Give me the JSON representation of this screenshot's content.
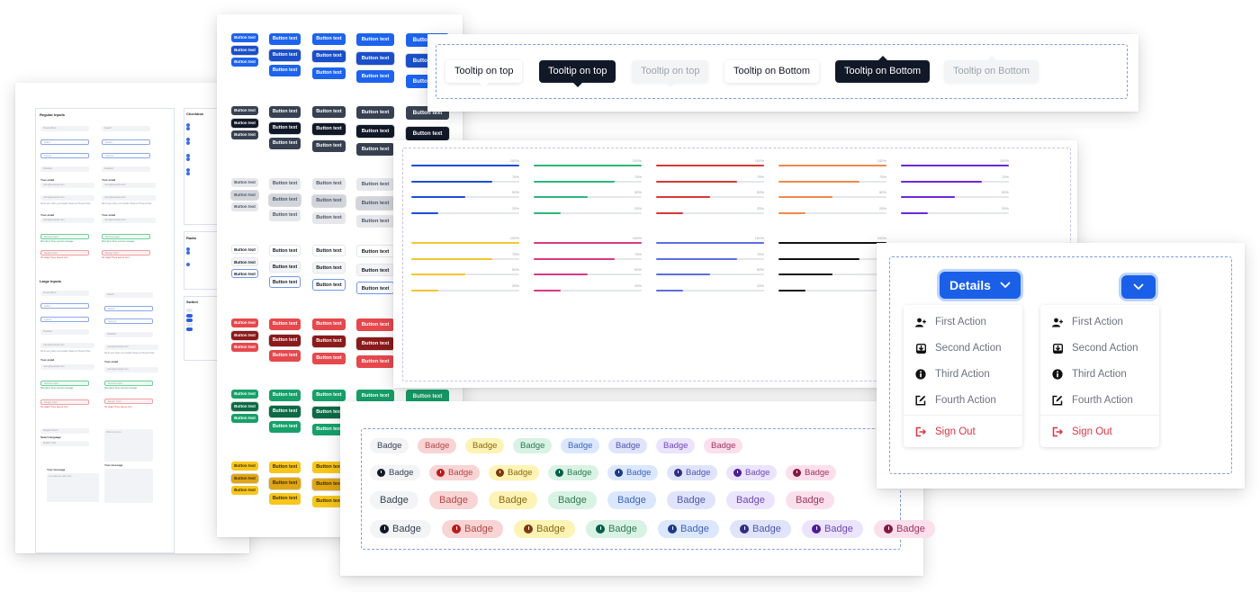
{
  "tooltips": {
    "items": [
      {
        "label": "Tooltip on top",
        "variant": "light",
        "placement": "top"
      },
      {
        "label": "Tooltip on top",
        "variant": "dark",
        "placement": "top"
      },
      {
        "label": "Tooltip on top",
        "variant": "muted",
        "placement": "top"
      },
      {
        "label": "Tooltip on Bottom",
        "variant": "light",
        "placement": "bottom"
      },
      {
        "label": "Tooltip on Bottom",
        "variant": "dark",
        "placement": "bottom"
      },
      {
        "label": "Tooltip on Bottom",
        "variant": "muted",
        "placement": "bottom"
      }
    ]
  },
  "dropdowns": {
    "details_button": "Details",
    "icon_button": "chevron-down",
    "menus": [
      {
        "items": [
          {
            "label": "First Action",
            "icon": "user-plus-icon"
          },
          {
            "label": "Second Action",
            "icon": "download-box-icon"
          },
          {
            "label": "Third Action",
            "icon": "info-circle-icon"
          },
          {
            "label": "Fourth Action",
            "icon": "edit-icon"
          }
        ],
        "danger_item": {
          "label": "Sign Out",
          "icon": "sign-out-icon"
        }
      },
      {
        "items": [
          {
            "label": "First Action",
            "icon": "user-plus-icon"
          },
          {
            "label": "Second Action",
            "icon": "download-box-icon"
          },
          {
            "label": "Third Action",
            "icon": "info-circle-icon"
          },
          {
            "label": "Fourth Action",
            "icon": "edit-icon"
          }
        ],
        "danger_item": {
          "label": "Sign Out",
          "icon": "sign-out-icon"
        }
      }
    ],
    "accent": "#1a5fe8",
    "danger": "#dc3545"
  },
  "badges": {
    "label": "Badge",
    "icon": "clock-icon",
    "palettes": [
      {
        "name": "gray",
        "bg": "#f3f4f6",
        "fg": "#374151",
        "icon": "#111827"
      },
      {
        "name": "red",
        "bg": "#f8d4d4",
        "fg": "#b54848",
        "icon": "#b91c1c"
      },
      {
        "name": "yellow",
        "bg": "#fdf3b5",
        "fg": "#8a6a10",
        "icon": "#7c3a10"
      },
      {
        "name": "green",
        "bg": "#d8f2e4",
        "fg": "#2f7a55",
        "icon": "#065f46"
      },
      {
        "name": "blue",
        "bg": "#dbe7fd",
        "fg": "#3e64b8",
        "icon": "#1e3a8a"
      },
      {
        "name": "indigo",
        "bg": "#e0e4fb",
        "fg": "#4d55b0",
        "icon": "#312e81"
      },
      {
        "name": "purple",
        "bg": "#ebe4fc",
        "fg": "#6d48b8",
        "icon": "#4c1d95"
      },
      {
        "name": "pink",
        "bg": "#fbe0eb",
        "fg": "#a2335e",
        "icon": "#831843"
      }
    ],
    "rows": [
      {
        "size": "small",
        "with_icon": false
      },
      {
        "size": "small",
        "with_icon": true
      },
      {
        "size": "large",
        "with_icon": false
      },
      {
        "size": "large",
        "with_icon": true
      }
    ]
  },
  "progress": {
    "groups": [
      {
        "color": "#1d4ed8",
        "values": [
          100,
          75,
          50,
          25
        ]
      },
      {
        "color": "#2fb57a",
        "values": [
          100,
          75,
          50,
          25
        ]
      },
      {
        "color": "#d63838",
        "values": [
          100,
          75,
          50,
          25
        ]
      },
      {
        "color": "#f0894a",
        "values": [
          100,
          75,
          50,
          25
        ]
      },
      {
        "color": "#6d28d9",
        "values": [
          100,
          75,
          50,
          25
        ]
      },
      {
        "color": "#f5c431",
        "values": [
          100,
          75,
          50,
          25
        ]
      },
      {
        "color": "#d83a86",
        "values": [
          100,
          75,
          50,
          25
        ]
      },
      {
        "color": "#5b6ee0",
        "values": [
          100,
          75,
          50,
          25
        ]
      },
      {
        "color": "#111111",
        "values": [
          100,
          75,
          50,
          25
        ]
      }
    ]
  },
  "buttons": {
    "label": "Button text",
    "variants": [
      {
        "name": "primary",
        "colors": [
          "#1d63ed",
          "#1a4fcb",
          "#1d63ed"
        ],
        "fg": "#ffffff",
        "outline": false
      },
      {
        "name": "dark",
        "colors": [
          "#374151",
          "#111827",
          "#374151"
        ],
        "fg": "#ffffff",
        "outline": false
      },
      {
        "name": "light",
        "colors": [
          "#e5e7eb",
          "#d1d5db",
          "#e5e7eb"
        ],
        "fg": "#4b5563",
        "outline": false
      },
      {
        "name": "white",
        "colors": [
          "#ffffff",
          "#f3f4f6",
          "#ffffff"
        ],
        "fg": "#111827",
        "outline": true
      },
      {
        "name": "danger",
        "colors": [
          "#e5484d",
          "#8b1a1a",
          "#e5484d"
        ],
        "fg": "#ffffff",
        "outline": false
      },
      {
        "name": "success",
        "colors": [
          "#16a06a",
          "#0b6b45",
          "#16a06a"
        ],
        "fg": "#ffffff",
        "outline": false
      },
      {
        "name": "warning",
        "colors": [
          "#f6c61c",
          "#e0a514",
          "#f6c61c"
        ],
        "fg": "#3b2a06",
        "outline": false
      }
    ]
  },
  "forms": {
    "regular_title": "Regular Inputs",
    "large_title": "Large Inputs",
    "checkbox_title": "Checkbox",
    "radio_title": "Radio",
    "switch_title": "Switch",
    "placeholders": {
      "simple": "Simple Block",
      "active": "Active",
      "typing": "Typing!",
      "disabled": "Disabled",
      "search": "Search",
      "search_typing": "Typing 2",
      "email": "name@example.com",
      "success": "Success Input",
      "danger": "Danger Input",
      "select": "Regular Select",
      "select_lang": "English (US)",
      "textarea": "Write text here...",
      "message": "Let make an order text..."
    },
    "labels": {
      "your_email": "Your email",
      "select_language": "Select language",
      "your_message": "Your message"
    },
    "hints": {
      "privacy": "We'll never share your details. Read our Privacy Policy",
      "success": "Well done! Some success message",
      "danger": "Oh snapp! There was an error"
    }
  }
}
